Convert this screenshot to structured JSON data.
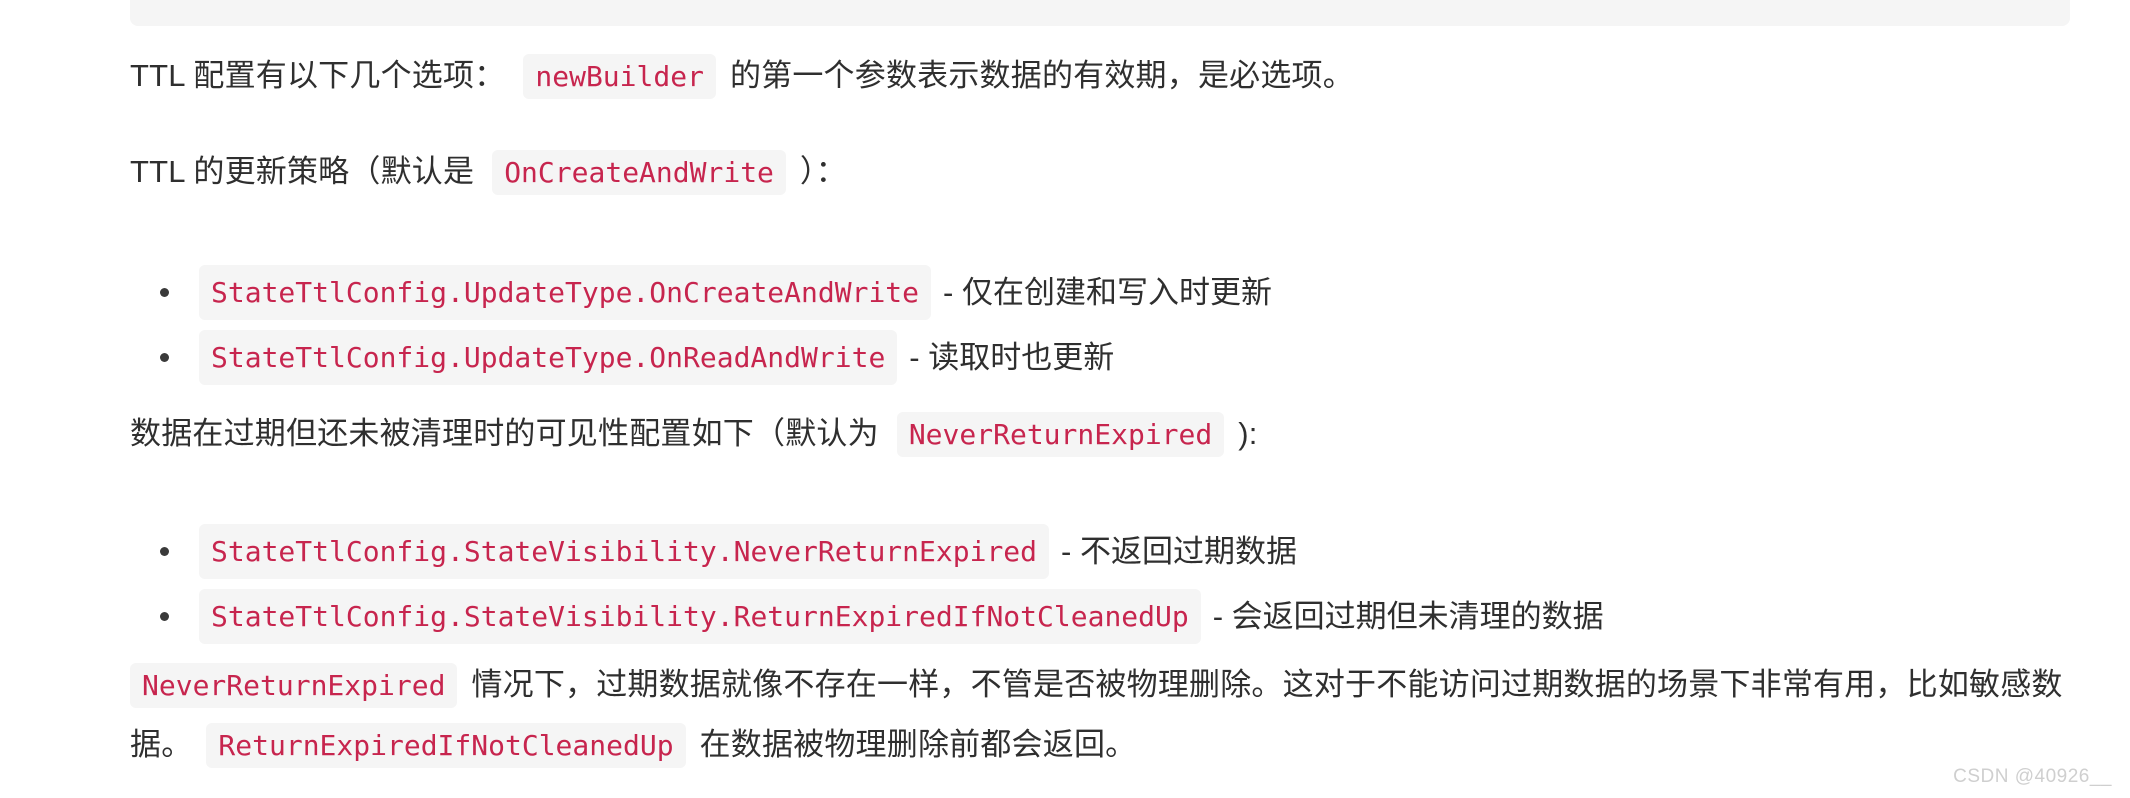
{
  "page": {
    "background_color": "#ffffff",
    "text_color": "#2f2f2f",
    "code_text_color": "#c7254e",
    "code_bg_color": "#f5f5f5"
  },
  "code_block_tail": {
    "name": "code-block-bottom-edge"
  },
  "paragraphs": {
    "ttl_options": {
      "lead": "TTL 配置有以下几个选项：",
      "code": "newBuilder",
      "tail": "的第一个参数表示数据的有效期，是必选项。"
    },
    "ttl_update": {
      "lead": "TTL 的更新策略（默认是",
      "code": "OnCreateAndWrite",
      "tail": "）："
    },
    "visibility": {
      "lead": "数据在过期但还未被清理时的可见性配置如下（默认为",
      "code": "NeverReturnExpired",
      "tail": "):"
    },
    "summary": {
      "code1": "NeverReturnExpired",
      "text1": "情况下，过期数据就像不存在一样，不管是否被物理删除。这对于不能访问过期数据的场景下非常有用，比如敏感数据。",
      "code2": "ReturnExpiredIfNotCleanedUp",
      "text2": "在数据被物理删除前都会返回。"
    }
  },
  "update_type_list": [
    {
      "code": "StateTtlConfig.UpdateType.OnCreateAndWrite",
      "description": "- 仅在创建和写入时更新"
    },
    {
      "code": "StateTtlConfig.UpdateType.OnReadAndWrite",
      "description": "- 读取时也更新"
    }
  ],
  "visibility_list": [
    {
      "code": "StateTtlConfig.StateVisibility.NeverReturnExpired",
      "description": "- 不返回过期数据"
    },
    {
      "code": "StateTtlConfig.StateVisibility.ReturnExpiredIfNotCleanedUp",
      "description": "- 会返回过期但未清理的数据"
    }
  ],
  "watermark": {
    "text": "CSDN @40926__"
  }
}
